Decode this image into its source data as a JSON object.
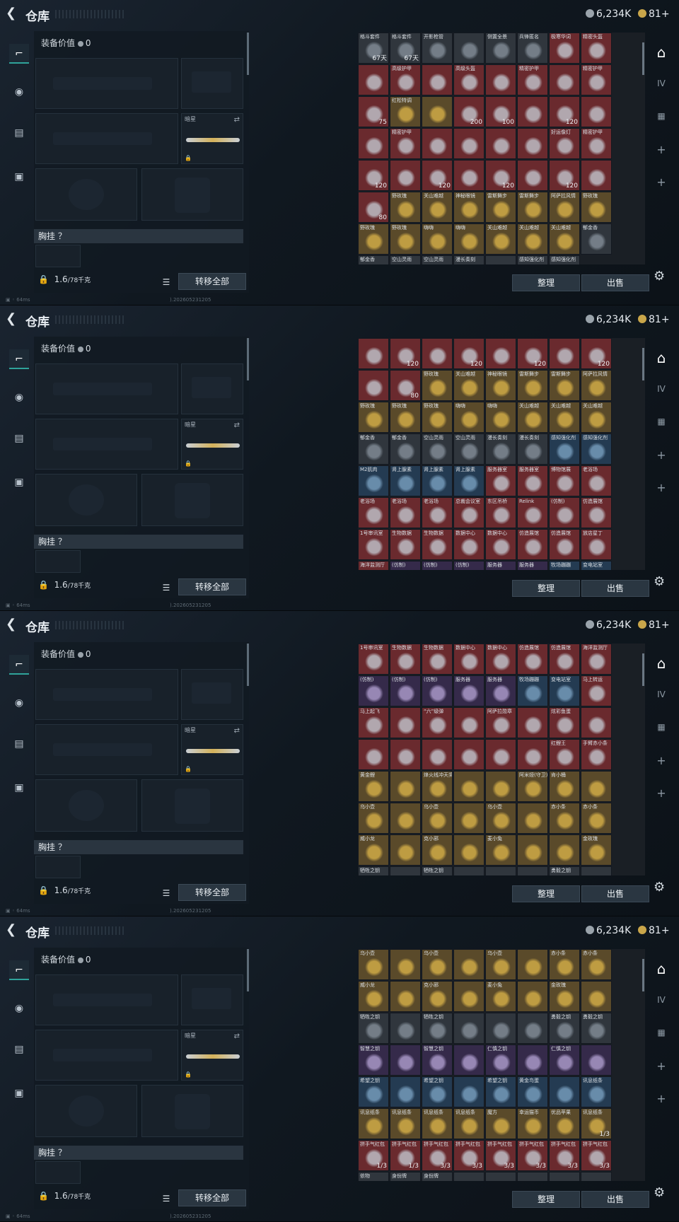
{
  "header": {
    "title": "仓库",
    "silver": "6,234K",
    "gold": "81+"
  },
  "left": {
    "tabs": [
      "weapon-icon",
      "helmet-icon",
      "backpack-icon",
      "briefcase-icon"
    ],
    "equip_value_label": "装备价值",
    "equip_value": "0",
    "slot_label": "暗星",
    "chest_label": "胸挂 ？",
    "weight": "1.6",
    "weight_cap": "/78千克",
    "transfer_label": "转移全部"
  },
  "status": {
    "ping": "64ms",
    "build": ").202605231205"
  },
  "right": {
    "sort_label": "整理",
    "sell_label": "出售",
    "tabs": [
      "mask-icon",
      "iv-icon",
      "chest-icon",
      "plus-icon"
    ]
  },
  "colors": {
    "accent": "#2fa39a",
    "red": "#6a2a2e",
    "gold": "#5a4a2a",
    "blue": "#243b52",
    "purple": "#352a4a",
    "gray": "#30363d"
  },
  "screens": [
    {
      "cells": [
        [
          "格斗套件",
          "gray",
          "67天"
        ],
        [
          "格斗套件",
          "gray",
          "67天"
        ],
        [
          "开影枪管",
          "gray",
          ""
        ],
        [
          "",
          ""
        ],
        [
          "侧置全景",
          "gray",
          ""
        ],
        [
          "兵锋匿名",
          "gray",
          ""
        ],
        [
          "极寒华词",
          "red",
          ""
        ],
        [
          "精密头盔",
          "red",
          ""
        ],
        [
          "",
          "red",
          ""
        ],
        [
          "高级护甲",
          "red",
          ""
        ],
        [
          "",
          "red",
          ""
        ],
        [
          "高级头盔",
          "red",
          ""
        ],
        [
          "",
          "red",
          ""
        ],
        [
          "精密护甲",
          "red",
          ""
        ],
        [
          "",
          "red",
          ""
        ],
        [
          "精密护甲",
          "red",
          ""
        ],
        [
          "",
          "red",
          "75"
        ],
        [
          "红松特调",
          "gold",
          ""
        ],
        [
          "",
          "gold",
          ""
        ],
        [
          "",
          "red",
          "200"
        ],
        [
          "",
          "red",
          "100"
        ],
        [
          "",
          "red",
          ""
        ],
        [
          "",
          "red",
          "120"
        ],
        [
          "",
          "red",
          ""
        ],
        [
          "",
          "red",
          ""
        ],
        [
          "精密护甲",
          "red",
          ""
        ],
        [
          "",
          "red",
          ""
        ],
        [
          "",
          "red",
          ""
        ],
        [
          "",
          "red",
          ""
        ],
        [
          "",
          "red",
          ""
        ],
        [
          "好运像灯",
          "red",
          ""
        ],
        [
          "精密护甲",
          "red",
          ""
        ],
        [
          "",
          "red",
          "120"
        ],
        [
          "",
          "red",
          ""
        ],
        [
          "",
          "red",
          "120"
        ],
        [
          "",
          "red",
          ""
        ],
        [
          "",
          "red",
          "120"
        ],
        [
          "",
          "red",
          ""
        ],
        [
          "",
          "red",
          "120"
        ],
        [
          "",
          "red",
          ""
        ],
        [
          "",
          "red",
          "80"
        ],
        [
          "野玫瑰",
          "gold",
          ""
        ],
        [
          "关山难越",
          "gold",
          ""
        ],
        [
          "神秘眼镜",
          "gold",
          ""
        ],
        [
          "雷斯舞步",
          "gold",
          ""
        ],
        [
          "雷斯舞步",
          "gold",
          ""
        ],
        [
          "阿萨拉风情",
          "gold",
          ""
        ],
        [
          "野玫瑰",
          "gold",
          ""
        ],
        [
          "野玫瑰",
          "gold",
          ""
        ],
        [
          "野玫瑰",
          "gold",
          ""
        ],
        [
          "嗨嗨",
          "gold",
          ""
        ],
        [
          "嗨嗨",
          "gold",
          ""
        ],
        [
          "关山难越",
          "gold",
          ""
        ],
        [
          "关山难越",
          "gold",
          ""
        ],
        [
          "关山难越",
          "gold",
          ""
        ],
        [
          "郁金香",
          "gray",
          ""
        ],
        [
          "郁金香",
          "gray",
          ""
        ],
        [
          "空山灵雨",
          "gray",
          ""
        ],
        [
          "空山灵雨",
          "gray",
          ""
        ],
        [
          "漫长奏刻",
          "gray",
          ""
        ],
        [
          "",
          "gray",
          ""
        ],
        [
          "感知强化剂",
          "gray",
          ""
        ],
        [
          "感知强化剂",
          "gray",
          ""
        ]
      ]
    },
    {
      "cells": [
        [
          "",
          "red",
          ""
        ],
        [
          "",
          "red",
          "120"
        ],
        [
          "",
          "red",
          ""
        ],
        [
          "",
          "red",
          "120"
        ],
        [
          "",
          "red",
          ""
        ],
        [
          "",
          "red",
          "120"
        ],
        [
          "",
          "red",
          ""
        ],
        [
          "",
          "red",
          "120"
        ],
        [
          "",
          "red",
          ""
        ],
        [
          "",
          "red",
          "80"
        ],
        [
          "野玫瑰",
          "gold",
          ""
        ],
        [
          "关山难越",
          "gold",
          ""
        ],
        [
          "神秘眼镜",
          "gold",
          ""
        ],
        [
          "雷斯舞步",
          "gold",
          ""
        ],
        [
          "雷斯舞步",
          "gold",
          ""
        ],
        [
          "阿萨拉风情",
          "gold",
          ""
        ],
        [
          "野玫瑰",
          "gold",
          ""
        ],
        [
          "野玫瑰",
          "gold",
          ""
        ],
        [
          "野玫瑰",
          "gold",
          ""
        ],
        [
          "嗨嗨",
          "gold",
          ""
        ],
        [
          "嗨嗨",
          "gold",
          ""
        ],
        [
          "关山难越",
          "gold",
          ""
        ],
        [
          "关山难越",
          "gold",
          ""
        ],
        [
          "关山难越",
          "gold",
          ""
        ],
        [
          "郁金香",
          "gray",
          ""
        ],
        [
          "郁金香",
          "gray",
          ""
        ],
        [
          "空山灵雨",
          "gray",
          ""
        ],
        [
          "空山灵雨",
          "gray",
          ""
        ],
        [
          "漫长奏刻",
          "gray",
          ""
        ],
        [
          "漫长奏刻",
          "gray",
          ""
        ],
        [
          "感知强化剂",
          "blue",
          ""
        ],
        [
          "感知强化剂",
          "blue",
          ""
        ],
        [
          "M2肌肉",
          "blue",
          ""
        ],
        [
          "肾上腺素",
          "blue",
          ""
        ],
        [
          "肾上腺素",
          "blue",
          ""
        ],
        [
          "肾上腺素",
          "blue",
          ""
        ],
        [
          "服务器室",
          "red",
          ""
        ],
        [
          "服务器室",
          "red",
          ""
        ],
        [
          "博物馆展",
          "red",
          ""
        ],
        [
          "老浴场",
          "red",
          ""
        ],
        [
          "老浴场",
          "red",
          ""
        ],
        [
          "老浴场",
          "red",
          ""
        ],
        [
          "老浴场",
          "red",
          ""
        ],
        [
          "总裁会议室",
          "red",
          ""
        ],
        [
          "东区吊桥",
          "red",
          ""
        ],
        [
          "Relink",
          "red",
          ""
        ],
        [
          "(仿制)",
          "red",
          ""
        ],
        [
          "仿造展馆",
          "red",
          ""
        ],
        [
          "1号审讯室",
          "red",
          ""
        ],
        [
          "生物数据",
          "red",
          ""
        ],
        [
          "生物数据",
          "red",
          ""
        ],
        [
          "数据中心",
          "red",
          ""
        ],
        [
          "数据中心",
          "red",
          ""
        ],
        [
          "仿造展馆",
          "red",
          ""
        ],
        [
          "仿造展馆",
          "red",
          ""
        ],
        [
          "放店星丁",
          "red",
          ""
        ],
        [
          "海洋监测厅",
          "red",
          ""
        ],
        [
          "(仿制)",
          "purple",
          ""
        ],
        [
          "(仿制)",
          "purple",
          ""
        ],
        [
          "(仿制)",
          "purple",
          ""
        ],
        [
          "服务器",
          "purple",
          ""
        ],
        [
          "服务器",
          "purple",
          ""
        ],
        [
          "牧场蹦蹦",
          "blue",
          ""
        ],
        [
          "变电站室",
          "blue",
          ""
        ]
      ]
    },
    {
      "cells": [
        [
          "1号审讯室",
          "red",
          ""
        ],
        [
          "生物数据",
          "red",
          ""
        ],
        [
          "生物数据",
          "red",
          ""
        ],
        [
          "数据中心",
          "red",
          ""
        ],
        [
          "数据中心",
          "red",
          ""
        ],
        [
          "仿造展馆",
          "red",
          ""
        ],
        [
          "仿造展馆",
          "red",
          ""
        ],
        [
          "海洋监测厅",
          "red",
          ""
        ],
        [
          "(仿制)",
          "purple",
          ""
        ],
        [
          "(仿制)",
          "purple",
          ""
        ],
        [
          "(仿制)",
          "purple",
          ""
        ],
        [
          "服务器",
          "purple",
          ""
        ],
        [
          "服务器",
          "purple",
          ""
        ],
        [
          "牧场蹦蹦",
          "blue",
          ""
        ],
        [
          "变电站室",
          "blue",
          ""
        ],
        [
          "马上转运",
          "red",
          ""
        ],
        [
          "马上起飞",
          "red",
          ""
        ],
        [
          "",
          "red",
          ""
        ],
        [
          "“六”级弹",
          "red",
          ""
        ],
        [
          "",
          "red",
          ""
        ],
        [
          "阿萨拉勋章",
          "red",
          ""
        ],
        [
          "",
          "red",
          ""
        ],
        [
          "炫彩鱼蛋",
          "red",
          ""
        ],
        [
          "",
          "red",
          ""
        ],
        [
          "",
          "red",
          ""
        ],
        [
          "",
          "red",
          ""
        ],
        [
          "",
          "red",
          ""
        ],
        [
          "",
          "red",
          ""
        ],
        [
          "",
          "red",
          ""
        ],
        [
          "",
          "red",
          ""
        ],
        [
          "红鲤王",
          "red",
          ""
        ],
        [
          "手臂赤小条",
          "red",
          ""
        ],
        [
          "黄金鲤",
          "gold",
          ""
        ],
        [
          "",
          "gold",
          ""
        ],
        [
          "烽火线冲天奖杯",
          "gold",
          ""
        ],
        [
          "",
          "gold",
          ""
        ],
        [
          "",
          "gold",
          ""
        ],
        [
          "阿米娅(守卫)",
          "gold",
          ""
        ],
        [
          "肯小桶",
          "gold",
          ""
        ],
        [
          "",
          "gold",
          ""
        ],
        [
          "乌小壶",
          "gold",
          ""
        ],
        [
          "",
          "gold",
          ""
        ],
        [
          "乌小壶",
          "gold",
          ""
        ],
        [
          "",
          "gold",
          ""
        ],
        [
          "乌小壶",
          "gold",
          ""
        ],
        [
          "",
          "gold",
          ""
        ],
        [
          "赤小条",
          "gold",
          ""
        ],
        [
          "赤小条",
          "gold",
          ""
        ],
        [
          "威小龙",
          "gold",
          ""
        ],
        [
          "",
          "gold",
          ""
        ],
        [
          "克小邪",
          "gold",
          ""
        ],
        [
          "",
          "gold",
          ""
        ],
        [
          "麦小兔",
          "gold",
          ""
        ],
        [
          "",
          "gold",
          ""
        ],
        [
          "",
          "gold",
          ""
        ],
        [
          "金玫瑰",
          "gold",
          ""
        ],
        [
          "牺牲之钥",
          "gray",
          ""
        ],
        [
          "",
          "gray",
          ""
        ],
        [
          "牺牲之钥",
          "gray",
          ""
        ],
        [
          "",
          "gray",
          ""
        ],
        [
          "",
          "gray",
          ""
        ],
        [
          "",
          "gray",
          ""
        ],
        [
          "勇毅之钥",
          "gray",
          ""
        ],
        [
          "",
          "gray",
          ""
        ]
      ]
    },
    {
      "cells": [
        [
          "乌小壶",
          "gold",
          ""
        ],
        [
          "",
          "gold",
          ""
        ],
        [
          "乌小壶",
          "gold",
          ""
        ],
        [
          "",
          "gold",
          ""
        ],
        [
          "乌小壶",
          "gold",
          ""
        ],
        [
          "",
          "gold",
          ""
        ],
        [
          "赤小条",
          "gold",
          ""
        ],
        [
          "赤小条",
          "gold",
          ""
        ],
        [
          "威小龙",
          "gold",
          ""
        ],
        [
          "",
          "gold",
          ""
        ],
        [
          "克小邪",
          "gold",
          ""
        ],
        [
          "",
          "gold",
          ""
        ],
        [
          "麦小兔",
          "gold",
          ""
        ],
        [
          "",
          "gold",
          ""
        ],
        [
          "金玫瑰",
          "gold",
          ""
        ],
        [
          "",
          "gold",
          ""
        ],
        [
          "牺牲之钥",
          "gray",
          ""
        ],
        [
          "",
          "gray",
          ""
        ],
        [
          "牺牲之钥",
          "gray",
          ""
        ],
        [
          "",
          "gray",
          ""
        ],
        [
          "",
          "gray",
          ""
        ],
        [
          "",
          "gray",
          ""
        ],
        [
          "勇毅之钥",
          "gray",
          ""
        ],
        [
          "勇毅之钥",
          "gray",
          ""
        ],
        [
          "智慧之钥",
          "purple",
          ""
        ],
        [
          "",
          "purple",
          ""
        ],
        [
          "智慧之钥",
          "purple",
          ""
        ],
        [
          "",
          "purple",
          ""
        ],
        [
          "仁慎之钥",
          "purple",
          ""
        ],
        [
          "",
          "purple",
          ""
        ],
        [
          "仁慎之钥",
          "purple",
          ""
        ],
        [
          "",
          "purple",
          ""
        ],
        [
          "希望之钥",
          "blue",
          ""
        ],
        [
          "",
          "blue",
          ""
        ],
        [
          "希望之钥",
          "blue",
          ""
        ],
        [
          "",
          "blue",
          ""
        ],
        [
          "希望之钥",
          "blue",
          ""
        ],
        [
          "黄金鸟蛋",
          "blue",
          ""
        ],
        [
          "",
          "blue",
          ""
        ],
        [
          "讯息纸条",
          "blue",
          ""
        ],
        [
          "讯息纸条",
          "gold",
          ""
        ],
        [
          "讯息纸条",
          "gold",
          ""
        ],
        [
          "讯息纸条",
          "gold",
          ""
        ],
        [
          "讯息纸条",
          "gold",
          ""
        ],
        [
          "魔方",
          "gold",
          ""
        ],
        [
          "幸运猫币",
          "gold",
          ""
        ],
        [
          "优品苹果",
          "gold",
          ""
        ],
        [
          "讯息纸条",
          "gold",
          "1/3"
        ],
        [
          "拼手气红包",
          "red",
          "1/3"
        ],
        [
          "拼手气红包",
          "red",
          "1/3"
        ],
        [
          "拼手气红包",
          "red",
          "3/3"
        ],
        [
          "拼手气红包",
          "red",
          "3/3"
        ],
        [
          "拼手气红包",
          "red",
          "3/3"
        ],
        [
          "拼手气红包",
          "red",
          "3/3"
        ],
        [
          "拼手气红包",
          "red",
          "3/3"
        ],
        [
          "拼手气红包",
          "red",
          "3/3"
        ],
        [
          "依物",
          "gray",
          ""
        ],
        [
          "身份牌",
          "gray",
          ""
        ],
        [
          "身份牌",
          "gray",
          ""
        ],
        [
          "",
          "gray",
          ""
        ],
        [
          "",
          "gray",
          ""
        ],
        [
          "",
          "gray",
          ""
        ],
        [
          "",
          "gray",
          ""
        ],
        [
          "",
          "gray",
          ""
        ]
      ]
    }
  ]
}
